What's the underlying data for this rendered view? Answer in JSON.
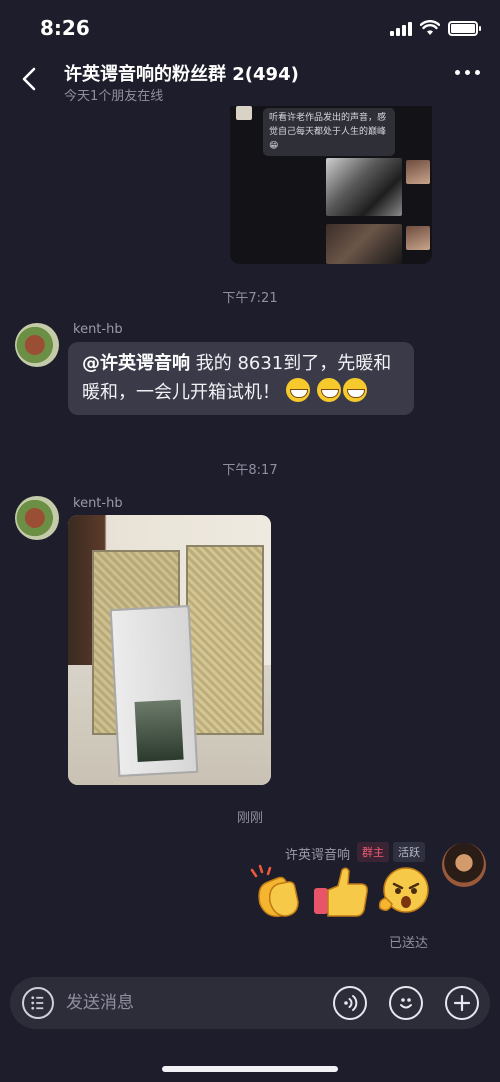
{
  "status_bar": {
    "time": "8:26"
  },
  "header": {
    "title": "许英谔音响的粉丝群 2(494)",
    "subtitle": "今天1个朋友在线"
  },
  "shared_card": {
    "text": "听看许老作品发出的声音，感觉自己每天都处于人生的巅峰😁"
  },
  "messages": [
    {
      "time": "下午7:21"
    },
    {
      "sender": "kent-hb",
      "mention": "@许英谔音响",
      "text": " 我的 8631到了，先暖和暖和，一会儿开箱试机！"
    },
    {
      "time": "下午8:17"
    },
    {
      "sender": "kent-hb"
    },
    {
      "time": "刚刚"
    },
    {
      "sender": "许英谔音响",
      "badge_owner": "群主",
      "badge_active": "活跃",
      "status": "已送达"
    }
  ],
  "input": {
    "placeholder": "发送消息"
  },
  "colors": {
    "background": "#1d1d2b",
    "bubble": "#3a3a48",
    "owner_badge": "#f05a74"
  }
}
